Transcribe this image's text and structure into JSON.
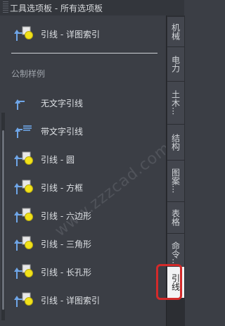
{
  "palette": {
    "title": "工具选项板 - 所有选项板",
    "header_item": {
      "label": "引线 - 详图索引",
      "icon": "leader-callout-icon"
    },
    "section_title": "公制样例",
    "items": [
      {
        "label": "无文字引线",
        "icon": "leader-no-text-icon"
      },
      {
        "label": "带文字引线",
        "icon": "leader-with-text-icon"
      },
      {
        "label": "引线 - 圆",
        "icon": "leader-circle-icon"
      },
      {
        "label": "引线 - 方框",
        "icon": "leader-box-icon"
      },
      {
        "label": "引线 - 六边形",
        "icon": "leader-hexagon-icon"
      },
      {
        "label": "引线 - 三角形",
        "icon": "leader-triangle-icon"
      },
      {
        "label": "引线 - 长孔形",
        "icon": "leader-slot-icon"
      },
      {
        "label": "引线 - 详图索引",
        "icon": "leader-callout-icon"
      }
    ]
  },
  "tabs": [
    {
      "label": "机械",
      "active": false
    },
    {
      "label": "电力",
      "active": false
    },
    {
      "label": "土木...",
      "active": false
    },
    {
      "label": "结构",
      "active": false
    },
    {
      "label": "图案...",
      "active": false
    },
    {
      "label": "表格",
      "active": false
    },
    {
      "label": "命令...",
      "active": false
    },
    {
      "label": "引线",
      "active": true
    }
  ],
  "watermark": "www.zzzcad.com",
  "colors": {
    "accent": "#d32a2a",
    "icon_blue": "#6fa6e8",
    "icon_yellow": "#f2e21a"
  }
}
